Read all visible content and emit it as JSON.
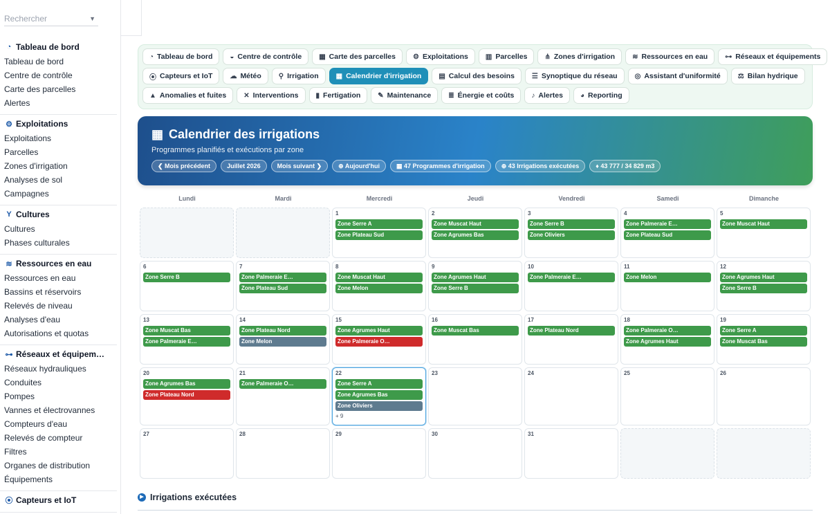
{
  "sidebar": {
    "search_placeholder": "Rechercher",
    "sections": [
      {
        "title": "Tableau de bord",
        "icon": "dashboard-icon",
        "items": [
          "Tableau de bord",
          "Centre de contrôle",
          "Carte des parcelles",
          "Alertes"
        ]
      },
      {
        "title": "Exploitations",
        "icon": "farm-icon",
        "items": [
          "Exploitations",
          "Parcelles",
          "Zones d'irrigation",
          "Analyses de sol",
          "Campagnes"
        ]
      },
      {
        "title": "Cultures",
        "icon": "seedling-icon",
        "items": [
          "Cultures",
          "Phases culturales"
        ]
      },
      {
        "title": "Ressources en eau",
        "icon": "water-icon",
        "items": [
          "Ressources en eau",
          "Bassins et réservoirs",
          "Relevés de niveau",
          "Analyses d'eau",
          "Autorisations et quotas"
        ]
      },
      {
        "title": "Réseaux et équipem…",
        "icon": "network-icon",
        "items": [
          "Réseaux hydrauliques",
          "Conduites",
          "Pompes",
          "Vannes et électrovannes",
          "Compteurs d'eau",
          "Relevés de compteur",
          "Filtres",
          "Organes de distribution",
          "Équipements"
        ]
      },
      {
        "title": "Capteurs et IoT",
        "icon": "sensor-icon",
        "items": []
      }
    ]
  },
  "toolbar": {
    "rows": [
      [
        {
          "label": "Tableau de bord",
          "icon": "dashboard-icon",
          "glyph": "◔"
        },
        {
          "label": "Centre de contrôle",
          "icon": "gauge-icon",
          "glyph": "◒"
        },
        {
          "label": "Carte des parcelles",
          "icon": "map-grid-icon",
          "glyph": "▦"
        },
        {
          "label": "Exploitations",
          "icon": "tractor-icon",
          "glyph": "⚙"
        },
        {
          "label": "Parcelles",
          "icon": "map-icon",
          "glyph": "▥"
        },
        {
          "label": "Zones d'irrigation",
          "icon": "sitemap-icon",
          "glyph": "⋔"
        },
        {
          "label": "Ressources en eau",
          "icon": "water-icon",
          "glyph": "≋"
        },
        {
          "label": "Réseaux et équipements",
          "icon": "network-icon",
          "glyph": "⊶"
        }
      ],
      [
        {
          "label": "Capteurs et IoT",
          "icon": "sensor-icon",
          "glyph": "⦿"
        },
        {
          "label": "Météo",
          "icon": "cloud-sun-icon",
          "glyph": "☁"
        },
        {
          "label": "Irrigation",
          "icon": "faucet-icon",
          "glyph": "⚲"
        },
        {
          "label": "Calendrier d'irrigation",
          "icon": "calendar-icon",
          "glyph": "▦",
          "active": true
        },
        {
          "label": "Calcul des besoins",
          "icon": "calculator-icon",
          "glyph": "▤"
        },
        {
          "label": "Synoptique du réseau",
          "icon": "list-icon",
          "glyph": "☰"
        },
        {
          "label": "Assistant d'uniformité",
          "icon": "bullseye-icon",
          "glyph": "◎"
        },
        {
          "label": "Bilan hydrique",
          "icon": "scale-icon",
          "glyph": "⚖"
        }
      ],
      [
        {
          "label": "Anomalies et fuites",
          "icon": "warning-icon",
          "glyph": "▲"
        },
        {
          "label": "Interventions",
          "icon": "tools-icon",
          "glyph": "✕"
        },
        {
          "label": "Fertigation",
          "icon": "flask-icon",
          "glyph": "▮"
        },
        {
          "label": "Maintenance",
          "icon": "wrench-icon",
          "glyph": "✎"
        },
        {
          "label": "Énergie et coûts",
          "icon": "bolt-icon",
          "glyph": "≣"
        },
        {
          "label": "Alertes",
          "icon": "bell-icon",
          "glyph": "♪"
        },
        {
          "label": "Reporting",
          "icon": "chart-pie-icon",
          "glyph": "◕"
        }
      ]
    ]
  },
  "hero": {
    "title": "Calendrier des irrigations",
    "subtitle": "Programmes planifiés et exécutions par zone",
    "pills": [
      {
        "label": "❮ Mois précédent",
        "name": "prev-month-button",
        "interactable": true
      },
      {
        "label": "Juillet 2026",
        "name": "current-month-badge",
        "interactable": false
      },
      {
        "label": "Mois suivant ❯",
        "name": "next-month-button",
        "interactable": true
      },
      {
        "label": "⊕ Aujourd'hui",
        "name": "today-button",
        "interactable": true
      },
      {
        "label": "▦ 47 Programmes d'irrigation",
        "name": "programs-count-badge",
        "interactable": false
      },
      {
        "label": "⊕ 43 Irrigations exécutées",
        "name": "executed-count-badge",
        "interactable": false
      },
      {
        "label": "♦ 43 777 / 34 829 m3",
        "name": "volume-badge",
        "interactable": false
      }
    ]
  },
  "calendar": {
    "weekdays": [
      "Lundi",
      "Mardi",
      "Mercredi",
      "Jeudi",
      "Vendredi",
      "Samedi",
      "Dimanche"
    ],
    "status_colors": {
      "ok": "#3e9a4a",
      "pending": "#5e7b8f",
      "fail": "#cf2b2b"
    },
    "cells": [
      {
        "day": "",
        "empty": true,
        "events": []
      },
      {
        "day": "",
        "empty": true,
        "events": []
      },
      {
        "day": "1",
        "events": [
          {
            "label": "Zone Serre A",
            "status": "ok"
          },
          {
            "label": "Zone Plateau Sud",
            "status": "ok"
          }
        ]
      },
      {
        "day": "2",
        "events": [
          {
            "label": "Zone Muscat Haut",
            "status": "ok"
          },
          {
            "label": "Zone Agrumes Bas",
            "status": "ok"
          }
        ]
      },
      {
        "day": "3",
        "events": [
          {
            "label": "Zone Serre B",
            "status": "ok"
          },
          {
            "label": "Zone Oliviers",
            "status": "ok"
          }
        ]
      },
      {
        "day": "4",
        "events": [
          {
            "label": "Zone Palmeraie E…",
            "status": "ok"
          },
          {
            "label": "Zone Plateau Sud",
            "status": "ok"
          }
        ]
      },
      {
        "day": "5",
        "events": [
          {
            "label": "Zone Muscat Haut",
            "status": "ok"
          }
        ]
      },
      {
        "day": "6",
        "events": [
          {
            "label": "Zone Serre B",
            "status": "ok"
          }
        ]
      },
      {
        "day": "7",
        "events": [
          {
            "label": "Zone Palmeraie E…",
            "status": "ok"
          },
          {
            "label": "Zone Plateau Sud",
            "status": "ok"
          }
        ]
      },
      {
        "day": "8",
        "events": [
          {
            "label": "Zone Muscat Haut",
            "status": "ok"
          },
          {
            "label": "Zone Melon",
            "status": "ok"
          }
        ]
      },
      {
        "day": "9",
        "events": [
          {
            "label": "Zone Agrumes Haut",
            "status": "ok"
          },
          {
            "label": "Zone Serre B",
            "status": "ok"
          }
        ]
      },
      {
        "day": "10",
        "events": [
          {
            "label": "Zone Palmeraie E…",
            "status": "ok"
          }
        ]
      },
      {
        "day": "11",
        "events": [
          {
            "label": "Zone Melon",
            "status": "ok"
          }
        ]
      },
      {
        "day": "12",
        "events": [
          {
            "label": "Zone Agrumes Haut",
            "status": "ok"
          },
          {
            "label": "Zone Serre B",
            "status": "ok"
          }
        ]
      },
      {
        "day": "13",
        "events": [
          {
            "label": "Zone Muscat Bas",
            "status": "ok"
          },
          {
            "label": "Zone Palmeraie E…",
            "status": "ok"
          }
        ]
      },
      {
        "day": "14",
        "events": [
          {
            "label": "Zone Plateau Nord",
            "status": "ok"
          },
          {
            "label": "Zone Melon",
            "status": "pending"
          }
        ]
      },
      {
        "day": "15",
        "events": [
          {
            "label": "Zone Agrumes Haut",
            "status": "ok"
          },
          {
            "label": "Zone Palmeraie O…",
            "status": "fail"
          }
        ]
      },
      {
        "day": "16",
        "events": [
          {
            "label": "Zone Muscat Bas",
            "status": "ok"
          }
        ]
      },
      {
        "day": "17",
        "events": [
          {
            "label": "Zone Plateau Nord",
            "status": "ok"
          }
        ]
      },
      {
        "day": "18",
        "events": [
          {
            "label": "Zone Palmeraie O…",
            "status": "ok"
          },
          {
            "label": "Zone Agrumes Haut",
            "status": "ok"
          }
        ]
      },
      {
        "day": "19",
        "events": [
          {
            "label": "Zone Serre A",
            "status": "ok"
          },
          {
            "label": "Zone Muscat Bas",
            "status": "ok"
          }
        ]
      },
      {
        "day": "20",
        "events": [
          {
            "label": "Zone Agrumes Bas",
            "status": "ok"
          },
          {
            "label": "Zone Plateau Nord",
            "status": "fail"
          }
        ]
      },
      {
        "day": "21",
        "events": [
          {
            "label": "Zone Palmeraie O…",
            "status": "ok"
          }
        ]
      },
      {
        "day": "22",
        "today": true,
        "events": [
          {
            "label": "Zone Serre A",
            "status": "ok"
          },
          {
            "label": "Zone Agrumes Bas",
            "status": "ok"
          },
          {
            "label": "Zone Oliviers",
            "status": "pending"
          }
        ],
        "more": "+ 9"
      },
      {
        "day": "23",
        "events": []
      },
      {
        "day": "24",
        "events": []
      },
      {
        "day": "25",
        "events": []
      },
      {
        "day": "26",
        "events": []
      },
      {
        "day": "27",
        "events": []
      },
      {
        "day": "28",
        "events": []
      },
      {
        "day": "29",
        "events": []
      },
      {
        "day": "30",
        "events": []
      },
      {
        "day": "31",
        "events": []
      },
      {
        "day": "",
        "empty": true,
        "events": []
      },
      {
        "day": "",
        "empty": true,
        "events": []
      }
    ]
  },
  "executed_section": {
    "title": "Irrigations exécutées"
  }
}
